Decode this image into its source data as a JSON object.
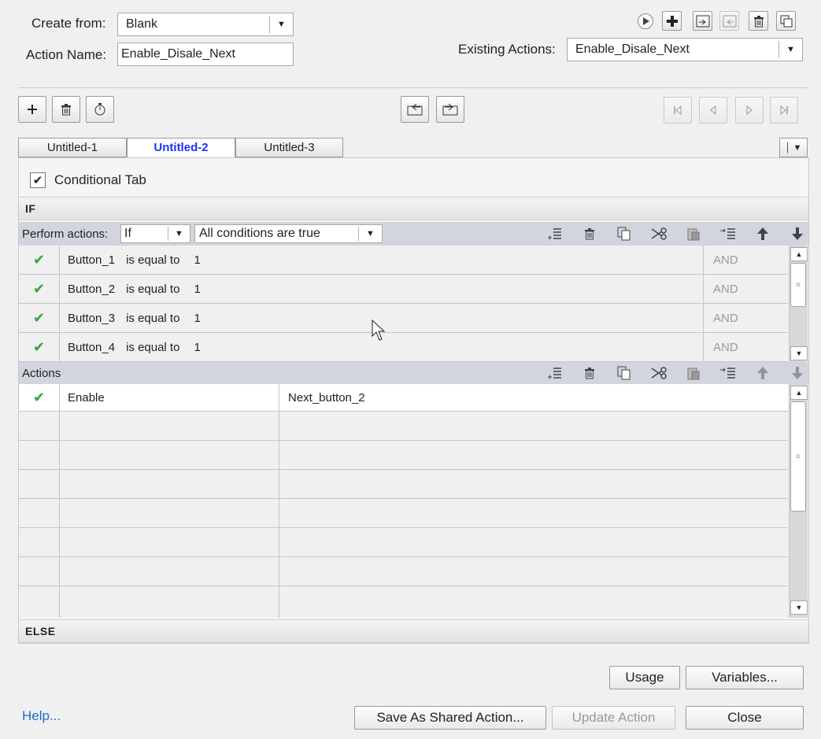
{
  "header": {
    "create_from_label": "Create from:",
    "create_from_value": "Blank",
    "action_name_label": "Action Name:",
    "action_name_value": "Enable_Disale_Next",
    "existing_actions_label": "Existing Actions:",
    "existing_actions_value": "Enable_Disale_Next"
  },
  "tabs": [
    {
      "label": "Untitled-1"
    },
    {
      "label": "Untitled-2"
    },
    {
      "label": "Untitled-3"
    }
  ],
  "conditional": {
    "label": "Conditional Tab",
    "checked": true,
    "check_glyph": "✔"
  },
  "if_section": {
    "label": "IF",
    "perform_actions_label": "Perform actions:",
    "perform_value": "If",
    "conditions_value": "All conditions are true",
    "rows": [
      {
        "var": "Button_1",
        "op": "is equal to",
        "val": "1",
        "logic": "AND"
      },
      {
        "var": "Button_2",
        "op": "is equal to",
        "val": "1",
        "logic": "AND"
      },
      {
        "var": "Button_3",
        "op": "is equal to",
        "val": "1",
        "logic": "AND"
      },
      {
        "var": "Button_4",
        "op": "is equal to",
        "val": "1",
        "logic": "AND"
      }
    ]
  },
  "actions_section": {
    "label": "Actions",
    "rows": [
      {
        "action": "Enable",
        "target": "Next_button_2"
      }
    ]
  },
  "else_section": {
    "label": "ELSE"
  },
  "footer": {
    "usage": "Usage",
    "variables": "Variables...",
    "help": "Help...",
    "save_shared": "Save As Shared Action...",
    "update": "Update Action",
    "close": "Close"
  },
  "icons": {
    "check": "checkmark-icon",
    "accent_check": "#3aa23a",
    "link_color": "#1f6dd6",
    "active_tab_color": "#1a33ff"
  }
}
